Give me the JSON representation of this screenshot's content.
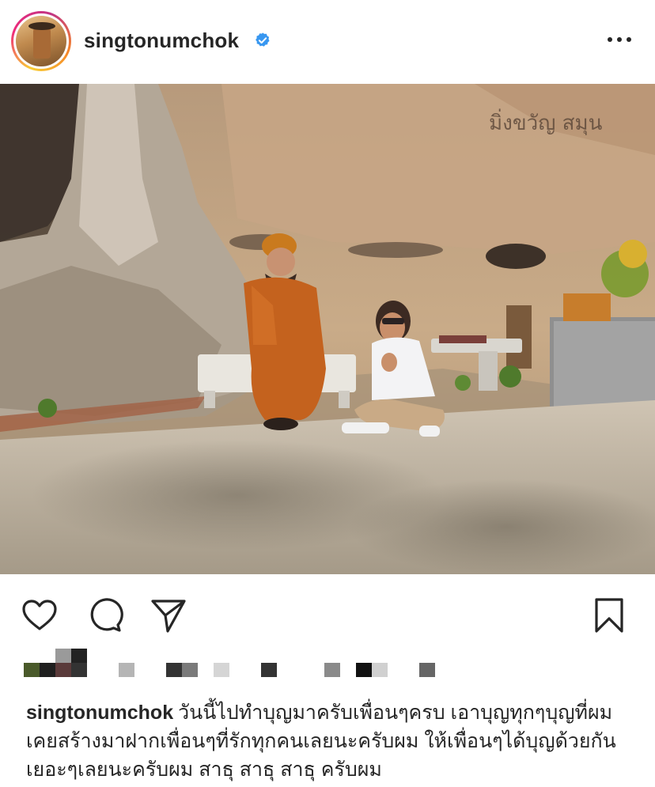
{
  "post": {
    "username": "singtonumchok",
    "verified": true,
    "caption_username": "singtonumchok",
    "caption_text": "วันนี้ไปทำบุญมาครับเพื่อนๆครบ เอาบุญทุกๆบุญที่ผมเคยสร้างมาฝากเพื่อนๆที่รักทุกคนเลยนะครับผม ให้เพื่อนๆได้บุญด้วยกันเยอะๆเลยนะครับผม สาธุ สาธุ สาธุ ครับผม",
    "photo_rock_text": "มิ่งขวัญ สมุน"
  },
  "icons": {
    "avatar": "profile-photo",
    "verified": "verified-badge-icon",
    "more": "more-options-icon",
    "like": "heart-icon",
    "comment": "comment-bubble-icon",
    "share": "paper-plane-icon",
    "save": "bookmark-icon"
  },
  "colors": {
    "verified_blue": "#3897f0",
    "text": "#262626",
    "story_ring_start": "#f9ce34",
    "story_ring_end": "#ee2a7b"
  }
}
